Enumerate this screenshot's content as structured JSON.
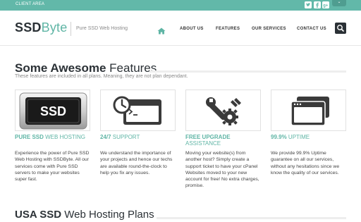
{
  "topbar": {
    "client_area": "CLIENT AREA",
    "social": [
      "twitter-icon",
      "facebook-icon",
      "google-plus-icon"
    ],
    "dropdown_glyph": "⌄",
    "color": "#62b8a9"
  },
  "header": {
    "logo_part1": "SSD",
    "logo_part2": "Byte",
    "tagline": "Pure SSD Web Hosting",
    "nav": {
      "home_icon": "home-icon",
      "about": "ABOUT US",
      "features": "FEATURES",
      "services": "OUR SERVICES",
      "contact": "CONTACT US"
    },
    "search_icon": "search-icon"
  },
  "features": {
    "title_bold": "Some Awesome",
    "title_rest": " Features",
    "subtitle": "These features are included in all plans. Meaning, they are not plan dependant.",
    "items": [
      {
        "icon": "ssd-badge-icon",
        "badge_text": "SSD",
        "title_bold": "PURE SSD",
        "title_rest": " WEB HOSTING",
        "description": "Experience the power of Pure SSD Web Hosting with SSDByte. All our services come with Pure SSD servers to make your websites super fast."
      },
      {
        "icon": "clock-terminal-icon",
        "title_bold": "24/7",
        "title_rest": " SUPPORT",
        "description": "We understand the importance of your projects and hence our techs are available round-the-clock to help you fix any issues."
      },
      {
        "icon": "wrench-gear-icon",
        "title_bold": "FREE UPGRADE",
        "title_rest": " ASSISTANCE",
        "description": "Moving your website(s) from another host? Simply create a support ticket to have your cPanel Websites moved to your new account for free! No extra charges, promise."
      },
      {
        "icon": "browser-windows-icon",
        "title_bold": "99.9%",
        "title_rest": " UPTIME",
        "description": "We provide 99.9% Uptime guarantee on all our services, without any hesitations since we know the quality of our services."
      }
    ]
  },
  "plans": {
    "title_bold": "USA SSD",
    "title_rest": " Web Hosting Plans"
  },
  "colors": {
    "accent": "#5fb5a5",
    "dark": "#2b3136"
  }
}
